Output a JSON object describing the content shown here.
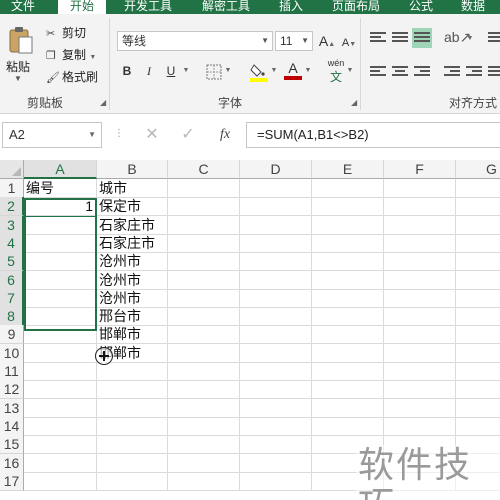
{
  "ribbon": {
    "tabs": [
      "文件",
      "开始",
      "开发工具",
      "解密工具",
      "插入",
      "页面布局",
      "公式",
      "数据"
    ],
    "active_tab": "开始",
    "clipboard": {
      "paste_label": "粘贴",
      "cut_label": "剪切",
      "copy_label": "复制",
      "format_painter_label": "格式刷",
      "group_label": "剪贴板"
    },
    "font": {
      "font_name": "等线",
      "font_size": "11",
      "grow_label": "A",
      "shrink_label": "A",
      "bold_label": "B",
      "italic_label": "I",
      "underline_label": "U",
      "font_color_label": "A",
      "pinyin_label": "wén",
      "group_label": "字体"
    },
    "alignment": {
      "group_label": "对齐方式"
    },
    "colors": {
      "accent": "#217346",
      "fill_highlight": "#ffff00",
      "font_color": "#c00000"
    }
  },
  "formula_bar": {
    "name_box": "A2",
    "fx_label": "fx",
    "formula": "=SUM(A1,B1<>B2)"
  },
  "sheet": {
    "columns": [
      "A",
      "B",
      "C",
      "D",
      "E",
      "F",
      "G"
    ],
    "rows": [
      "1",
      "2",
      "3",
      "4",
      "5",
      "6",
      "7",
      "8",
      "9",
      "10",
      "11",
      "12",
      "13",
      "14",
      "15",
      "16",
      "17"
    ],
    "cells": {
      "A1": "编号",
      "B1": "城市",
      "A2": "1",
      "B2": "保定市",
      "B3": "石家庄市",
      "B4": "石家庄市",
      "B5": "沧州市",
      "B6": "沧州市",
      "B7": "沧州市",
      "B8": "邢台市",
      "B9": "邯郸市",
      "B10": "邯郸市"
    },
    "active_cell": "A2",
    "selection": "A2:A8"
  },
  "watermark": "软件技巧"
}
